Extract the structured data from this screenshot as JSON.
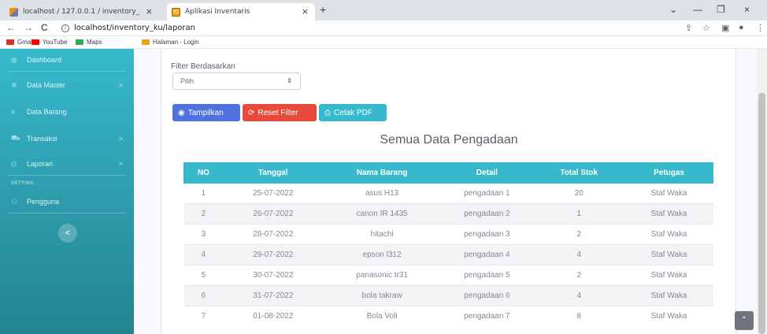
{
  "browser": {
    "tabs": [
      {
        "title": "localhost / 127.0.0.1 / inventory_",
        "favicon": "phpmyadmin-icon"
      },
      {
        "title": "Aplikasi Inventaris",
        "favicon": "app-icon",
        "active": true
      }
    ],
    "favicon_app_text": "IO",
    "url": "localhost/inventory_ku/laporan",
    "bookmarks": [
      {
        "label": "Gmail",
        "color": "#d93025"
      },
      {
        "label": "YouTube",
        "color": "#ff0000"
      },
      {
        "label": "Maps",
        "color": "#34a853"
      },
      {
        "label": "Halaman - Login",
        "color": "#e8a317"
      }
    ],
    "glyphs": {
      "close": "×",
      "newtab": "+",
      "back": "←",
      "forward": "→",
      "reload": "C",
      "minimize": "—",
      "restore": "❐",
      "window_close": "×",
      "chevron": "⌄",
      "share": "⇪",
      "star": "☆",
      "sidepanel": "▣",
      "profile": "●",
      "menu": "⋮",
      "info": "i"
    }
  },
  "sidebar": {
    "items": [
      {
        "label": "Dashboard",
        "icon": "dashboard-icon",
        "glyph": "◍"
      },
      {
        "label": "Data Master",
        "icon": "cog-icon",
        "glyph": "✲",
        "arrow": ">"
      },
      {
        "label": "Data Barang",
        "icon": "list-icon",
        "glyph": "≡"
      },
      {
        "label": "Transaksi",
        "icon": "cart-icon",
        "glyph": "⛟",
        "arrow": ">"
      },
      {
        "label": "Laporan",
        "icon": "print-icon",
        "glyph": "⎙",
        "arrow": ">"
      }
    ],
    "heading": "SETTING",
    "settings_item": {
      "label": "Pengguna",
      "icon": "users-icon",
      "glyph": "⚇"
    },
    "toggle_glyph": "<"
  },
  "filter": {
    "label": "Filter Berdasarkan",
    "select_value": "Pilih",
    "select_caret": "⇕"
  },
  "buttons": {
    "tampilkan": {
      "label": "Tampilkan",
      "glyph": "◉"
    },
    "reset": {
      "label": "Reset Filter",
      "glyph": "⟳"
    },
    "pdf": {
      "label": "Cetak PDF",
      "glyph": "⎙"
    }
  },
  "report": {
    "title": "Semua Data Pengadaan",
    "columns": [
      "NO",
      "Tanggal",
      "Nama Barang",
      "Detail",
      "Total Stok",
      "Petugas"
    ],
    "rows": [
      [
        "1",
        "25-07-2022",
        "asus H13",
        "pengadaan 1",
        "20",
        "Staf Waka"
      ],
      [
        "2",
        "26-07-2022",
        "canon IR 1435",
        "pengadaan 2",
        "1",
        "Staf Waka"
      ],
      [
        "3",
        "28-07-2022",
        "hitachi",
        "pengadaan 3",
        "2",
        "Staf Waka"
      ],
      [
        "4",
        "29-07-2022",
        "epson l312",
        "pengadaan 4",
        "4",
        "Staf Waka"
      ],
      [
        "5",
        "30-07-2022",
        "panasonic tr31",
        "pengadaan 5",
        "2",
        "Staf Waka"
      ],
      [
        "6",
        "31-07-2022",
        "bola takraw",
        "pengadaan 6",
        "4",
        "Staf Waka"
      ],
      [
        "7",
        "01-08-2022",
        "Bola Voli",
        "pengadaan 7",
        "8",
        "Staf Waka"
      ]
    ]
  },
  "scroll_to_top_glyph": "⌃",
  "colors": {
    "primary": "#4e73df",
    "danger": "#e74a3b",
    "info": "#36b9cc",
    "sidebar": "#36b9cc"
  }
}
